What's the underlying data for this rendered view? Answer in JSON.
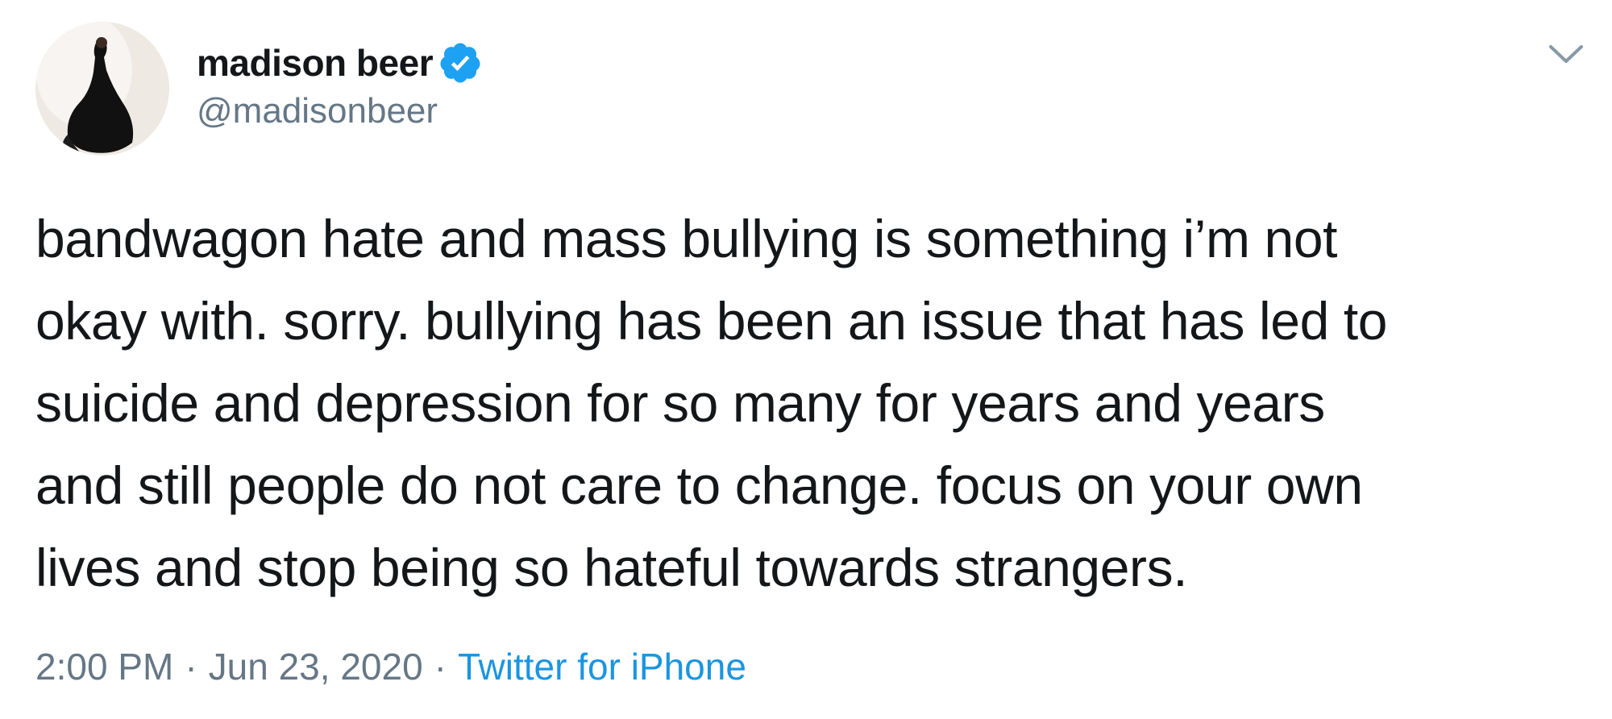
{
  "user": {
    "display_name": "madison beer",
    "handle": "@madisonbeer",
    "verified": true,
    "verified_icon": "verified-badge-icon"
  },
  "tweet": {
    "lines": [
      "bandwagon hate and mass bullying is something i’m not",
      "okay with. sorry. bullying has been an issue that has led to",
      "suicide and depression for so many for years and years",
      "and still people do not care to change. focus on your own",
      "lives and stop being so hateful towards strangers."
    ]
  },
  "meta": {
    "time": "2:00 PM",
    "separator": "·",
    "date": "Jun 23, 2020",
    "source": "Twitter for iPhone"
  },
  "colors": {
    "text": "#14171a",
    "secondary": "#657786",
    "accent": "#1b95e0",
    "verified": "#1da1f2"
  },
  "icons": {
    "more": "chevron-down-icon"
  }
}
